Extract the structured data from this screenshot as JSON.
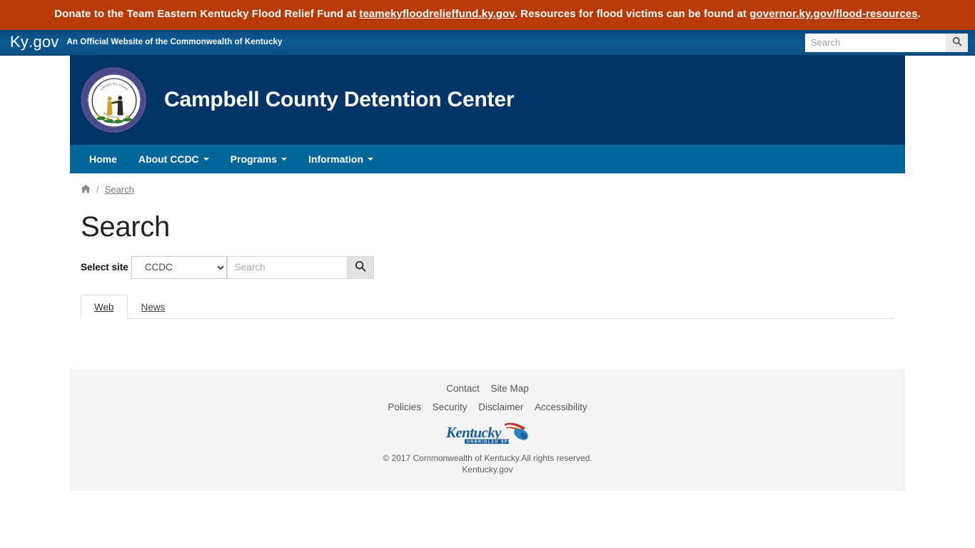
{
  "alert": {
    "text_before_link1": "Donate to the Team Eastern Kentucky Flood Relief Fund at ",
    "link1": "teamekyfloodrelieffund.ky.gov",
    "text_between": ". Resources for flood victims can be found at ",
    "link2": "governor.ky.gov/flood-resources",
    "text_after": ".",
    "background_color": "#b83a06"
  },
  "kygov": {
    "logo_light": "Ky",
    "logo_bold": ".gov",
    "tagline": "An Official Website of the Commonwealth of Kentucky",
    "search_placeholder": "Search",
    "search_value": "",
    "search_icon": "search-icon"
  },
  "site_header": {
    "title": "Campbell County Detention Center",
    "seal_alt": "Commonwealth of Kentucky seal",
    "seal_top_text": "COMMONWEALTH OF KENTUCKY",
    "seal_motto": "UNITED WE STAND",
    "seal_motto_bottom": "DIVIDED WE FALL",
    "background_color": "#013567"
  },
  "nav": {
    "background_color": "#006699",
    "items": [
      {
        "label": "Home",
        "has_caret": false
      },
      {
        "label": "About CCDC",
        "has_caret": true
      },
      {
        "label": "Programs",
        "has_caret": true
      },
      {
        "label": "Information",
        "has_caret": true
      }
    ]
  },
  "breadcrumb": {
    "home_icon": "home-icon",
    "separator": "/",
    "current": "Search"
  },
  "main": {
    "page_title": "Search",
    "select_label": "Select site",
    "select_value": "CCDC",
    "select_options": [
      "CCDC"
    ],
    "search_placeholder": "Search",
    "search_value": "",
    "search_button_icon": "search-icon",
    "tabs": [
      {
        "label": "Web",
        "active": true
      },
      {
        "label": "News",
        "active": false
      }
    ]
  },
  "footer": {
    "primary_links": [
      "Contact",
      "Site Map"
    ],
    "secondary_links": [
      "Policies",
      "Security",
      "Disclaimer",
      "Accessibility"
    ],
    "logo_text": "Kentucky",
    "logo_subtext": "UNBRIDLED SPIRIT",
    "copyright_line1": "© 2017 Commonwealth of Kentucky.All rights reserved.",
    "copyright_line2": "Kentucky.gov",
    "background_color": "#f4f4f4"
  }
}
